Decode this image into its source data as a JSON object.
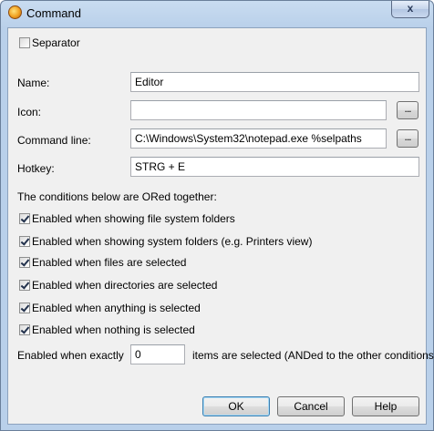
{
  "window": {
    "title": "Command",
    "close_glyph": "x"
  },
  "separator": {
    "label": "Separator",
    "checked": false
  },
  "fields": {
    "name_label": "Name:",
    "name_value": "Editor",
    "icon_label": "Icon:",
    "icon_value": "",
    "command_label": "Command line:",
    "command_value": "C:\\Windows\\System32\\notepad.exe %selpaths",
    "hotkey_label": "Hotkey:",
    "hotkey_value": "STRG + E",
    "browse_label": "..."
  },
  "conditions": {
    "heading": "The conditions below are ORed together:",
    "items": [
      {
        "label": "Enabled when showing file system folders",
        "checked": true
      },
      {
        "label": "Enabled when showing system folders (e.g. Printers view)",
        "checked": true
      },
      {
        "label": "Enabled when files are selected",
        "checked": true
      },
      {
        "label": "Enabled when directories are selected",
        "checked": true
      },
      {
        "label": "Enabled when anything is selected",
        "checked": true
      },
      {
        "label": "Enabled when nothing is selected",
        "checked": true
      }
    ],
    "exactly_label": "Enabled when exactly",
    "exactly_value": "0",
    "exactly_suffix": "items are selected (ANDed to the other conditions)"
  },
  "buttons": {
    "ok": "OK",
    "cancel": "Cancel",
    "help": "Help"
  },
  "icons": {
    "app": "app-logo-icon",
    "close": "close-icon"
  }
}
